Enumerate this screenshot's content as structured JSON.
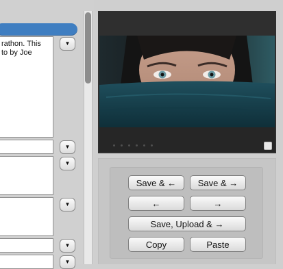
{
  "description_field": {
    "text": "rathon. This\nto by Joe"
  },
  "dropdown_glyph": "▼",
  "buttons": {
    "save_prev": "Save & ←",
    "save_next": "Save & →",
    "prev": "←",
    "next": "→",
    "save_upload_next": "Save, Upload & →",
    "copy": "Copy",
    "paste": "Paste"
  },
  "colors": {
    "accent_bar": "#3f7ec1",
    "preview_background": "#2f2f2f"
  }
}
